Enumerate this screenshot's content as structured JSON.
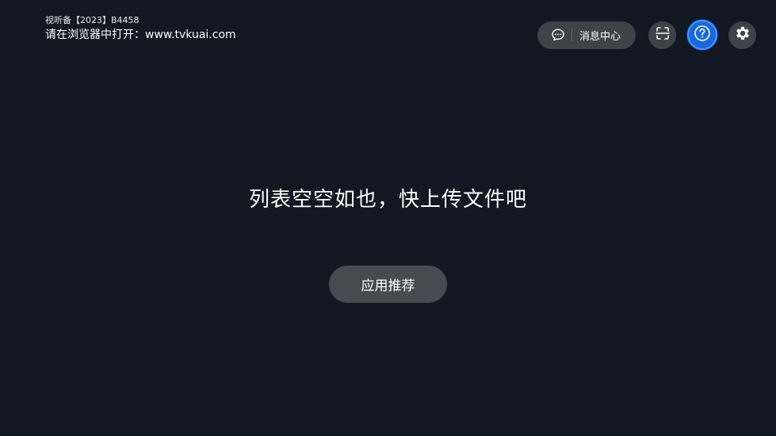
{
  "header": {
    "license_text": "视听备【2023】B4458",
    "open_hint": "请在浏览器中打开：www.tvkuai.com"
  },
  "toolbar": {
    "message_center": {
      "icon": "chat-bubble-icon",
      "label": "消息中心"
    },
    "scan_icon": "scan-icon",
    "help_icon": "help-question-icon",
    "settings_icon": "gear-icon",
    "accent_color": "#1769e0"
  },
  "main": {
    "empty_message": "列表空空如也，快上传文件吧",
    "recommend_button": "应用推荐"
  }
}
